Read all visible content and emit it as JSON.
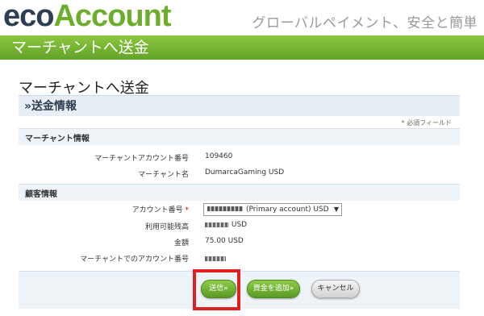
{
  "header": {
    "logo_eco": "eco",
    "logo_account": "Account",
    "tagline": "グローバルペイメント、安全と簡単"
  },
  "banner": {
    "title": "マーチャントへ送金"
  },
  "page": {
    "title": "マーチャントへ送金",
    "section_title": "»送金情報",
    "required_note": "* 必須フィールド"
  },
  "merchant": {
    "heading": "マーチャント情報",
    "account_label": "マーチャントアカウント番号",
    "account_value": "109460",
    "name_label": "マーチャント名",
    "name_value": "DumarcaGaming USD"
  },
  "customer": {
    "heading": "顧客情報",
    "account_label": "アカウント番号",
    "required_mark": "*",
    "account_select_value": "(Primary account) USD",
    "balance_label": "利用可能残高",
    "balance_currency": "USD",
    "amount_label": "金額",
    "amount_value": "75.00 USD",
    "merchant_account_label": "マーチャントでのアカウント番号"
  },
  "buttons": {
    "send": "送信»",
    "add_funds": "資金を追加»",
    "cancel": "キャンセル"
  },
  "colors": {
    "brand_green": "#6cae2c",
    "brand_navy": "#2f3e52",
    "highlight_red": "#e02020"
  }
}
